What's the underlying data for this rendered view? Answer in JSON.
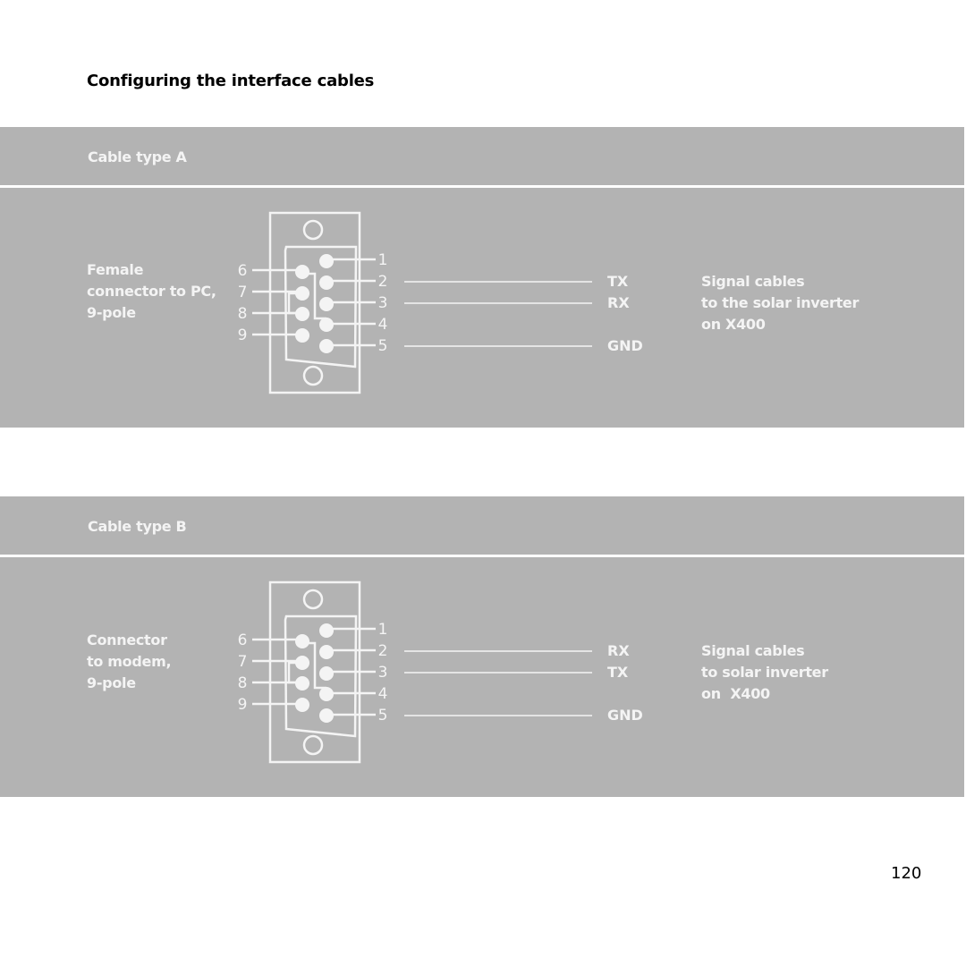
{
  "page": {
    "title": "Configuring the interface cables",
    "page_number": "120"
  },
  "colors": {
    "panel_bg": "#b3b3b3",
    "foreground": "#f4f4f4",
    "text": "#000000"
  },
  "cables": [
    {
      "header": "Cable type A",
      "connector_label": [
        "Female",
        "connector to PC,",
        "9-pole"
      ],
      "left_pins": [
        "6",
        "7",
        "8",
        "9"
      ],
      "right_pins": [
        "1",
        "2",
        "3",
        "4",
        "5"
      ],
      "signals": [
        {
          "pin": "2",
          "label": "TX"
        },
        {
          "pin": "3",
          "label": "RX"
        },
        {
          "pin": "5",
          "label": "GND"
        }
      ],
      "description": [
        "Signal cables",
        "to the solar inverter",
        "on X400"
      ]
    },
    {
      "header": "Cable type B",
      "connector_label": [
        "Connector",
        "to modem,",
        "9-pole"
      ],
      "left_pins": [
        "6",
        "7",
        "8",
        "9"
      ],
      "right_pins": [
        "1",
        "2",
        "3",
        "4",
        "5"
      ],
      "signals": [
        {
          "pin": "2",
          "label": "RX"
        },
        {
          "pin": "3",
          "label": "TX"
        },
        {
          "pin": "5",
          "label": "GND"
        }
      ],
      "description": [
        "Signal cables",
        "to solar inverter",
        "on  X400"
      ]
    }
  ]
}
